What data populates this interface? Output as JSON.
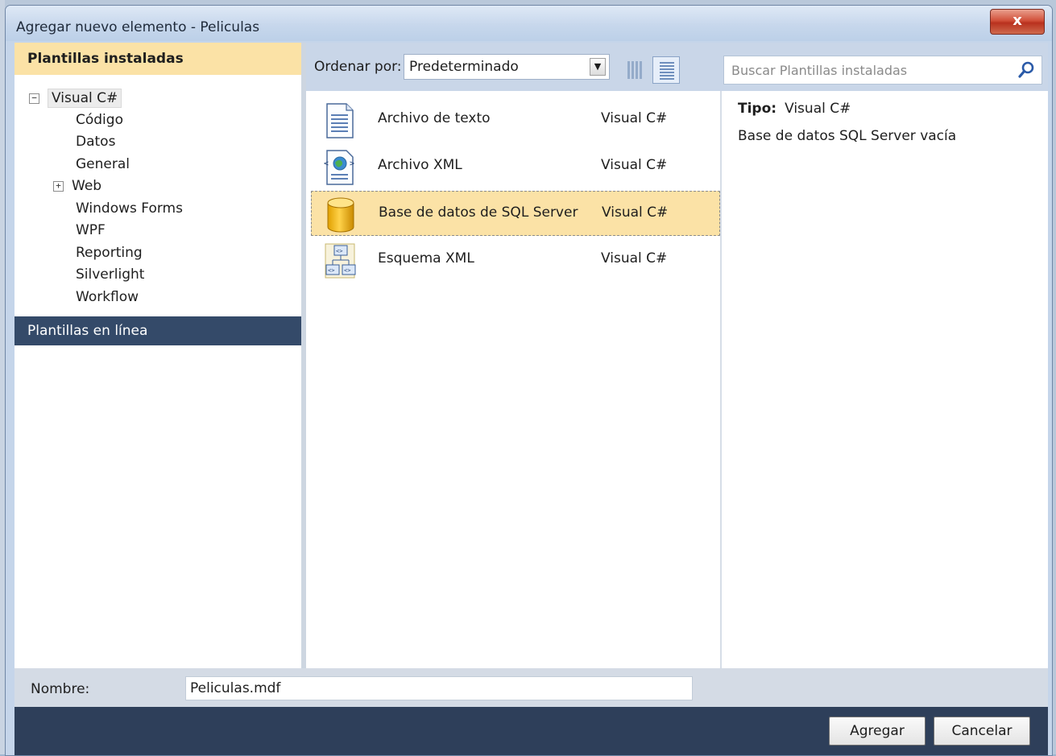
{
  "window": {
    "title": "Agregar nuevo elemento - Peliculas",
    "close_label": "x"
  },
  "left": {
    "header": "Plantillas instaladas",
    "root": {
      "label": "Visual C#",
      "expander": "−"
    },
    "children": [
      "Código",
      "Datos",
      "General",
      "Web",
      "Windows Forms",
      "WPF",
      "Reporting",
      "Silverlight",
      "Workflow"
    ],
    "web_expander": "+",
    "online": "Plantillas en línea"
  },
  "toolbar": {
    "sort_label": "Ordenar por:",
    "sort_value": "Predeterminado",
    "search_placeholder": "Buscar Plantillas instaladas"
  },
  "items": [
    {
      "name": "Archivo de texto",
      "lang": "Visual C#",
      "icon": "text-file-icon",
      "selected": false
    },
    {
      "name": "Archivo XML",
      "lang": "Visual C#",
      "icon": "xml-file-icon",
      "selected": false
    },
    {
      "name": "Base de datos de SQL Server",
      "lang": "Visual C#",
      "icon": "database-icon",
      "selected": true
    },
    {
      "name": "Esquema XML",
      "lang": "Visual C#",
      "icon": "xml-schema-icon",
      "selected": false
    }
  ],
  "details": {
    "tipo_label": "Tipo:",
    "tipo_value": "Visual C#",
    "description": "Base de datos SQL Server vacía"
  },
  "name_row": {
    "label": "Nombre:",
    "value": "Peliculas.mdf"
  },
  "footer": {
    "add": "Agregar",
    "cancel": "Cancelar"
  },
  "colors": {
    "selection": "#fbe2a6",
    "footer": "#2e3f5a",
    "online_band": "#344a69"
  }
}
